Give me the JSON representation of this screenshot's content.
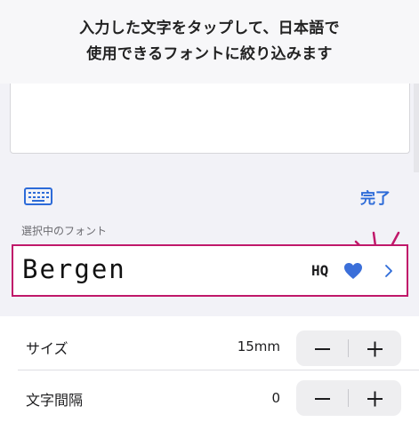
{
  "banner": {
    "line1": "入力した文字をタップして、日本語で",
    "line2": "使用できるフォントに絞り込みます"
  },
  "toolbar": {
    "keyboard_icon": "keyboard-icon",
    "done_label": "完了"
  },
  "font_section": {
    "label": "選択中のフォント",
    "font_name": "Bergen",
    "badge": "HQ",
    "favorite_icon": "heart-icon",
    "chevron_icon": "chevron-right-icon"
  },
  "settings": [
    {
      "label": "サイズ",
      "value": "15mm"
    },
    {
      "label": "文字間隔",
      "value": "0"
    }
  ],
  "colors": {
    "accent": "#2d6bd8",
    "highlight": "#c0186a",
    "heart": "#3b6fd9"
  }
}
